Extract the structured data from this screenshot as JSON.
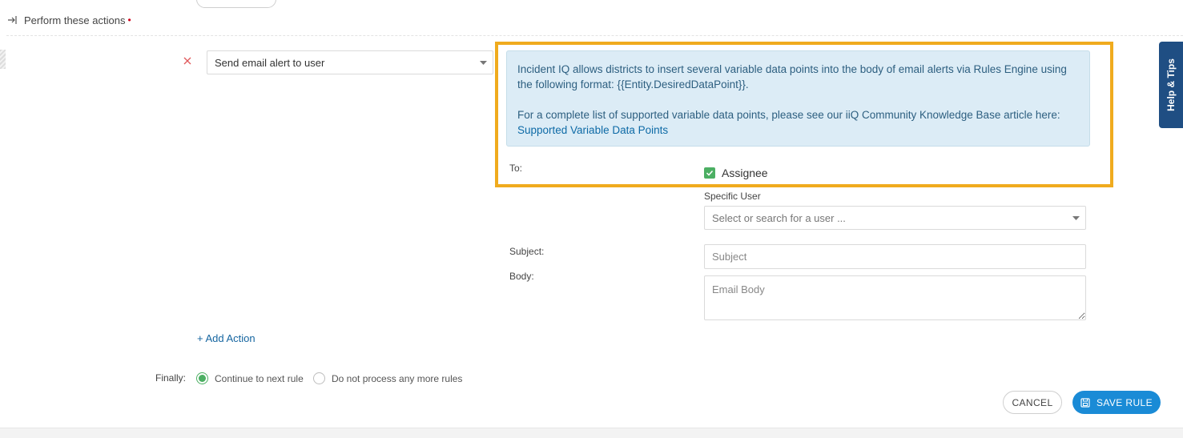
{
  "section": {
    "title": "Perform these actions",
    "required_marker": "•"
  },
  "action": {
    "selected": "Send email alert to user"
  },
  "info": {
    "line1": "Incident IQ allows districts to insert several variable data points into the body of email alerts via Rules Engine using the following format: {{Entity.DesiredDataPoint}}.",
    "line2_prefix": "For a complete list of supported variable data points, please see our iiQ Community Knowledge Base article here: ",
    "link_text": "Supported Variable Data Points"
  },
  "form": {
    "to_label": "To:",
    "assignee_label": "Assignee",
    "assignee_checked": true,
    "specific_user_label": "Specific User",
    "user_select_placeholder": "Select or search for a user ...",
    "subject_label": "Subject:",
    "subject_placeholder": "Subject",
    "body_label": "Body:",
    "body_placeholder": "Email Body"
  },
  "add_action_label": "+ Add Action",
  "finally": {
    "label": "Finally:",
    "options": [
      {
        "label": "Continue to next rule",
        "checked": true
      },
      {
        "label": "Do not process any more rules",
        "checked": false
      }
    ]
  },
  "buttons": {
    "cancel": "CANCEL",
    "save": "SAVE RULE"
  },
  "help_tab": "Help & Tips",
  "colors": {
    "highlight": "#f0ab1e",
    "info_bg": "#dcecf6",
    "primary": "#1a8bd6",
    "success": "#4caf63",
    "help_tab": "#1f4e83",
    "remove": "#e0585b"
  }
}
